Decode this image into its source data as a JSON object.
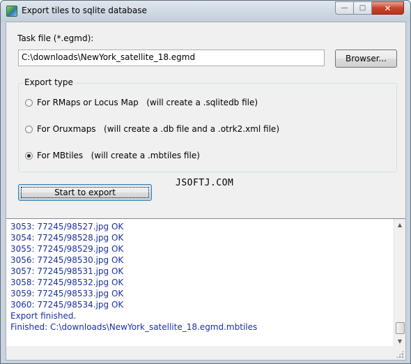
{
  "window": {
    "title": "Export tiles to sqlite database",
    "icon": "map-app-icon",
    "controls": {
      "minimize": "minimize-icon",
      "maximize": "maximize-icon",
      "close": "close-icon"
    }
  },
  "task": {
    "label": "Task file (*.egmd):",
    "value": "C:\\downloads\\NewYork_satellite_18.egmd",
    "browse_label": "Browser..."
  },
  "export_type": {
    "title": "Export type",
    "options": [
      {
        "label": "For RMaps or Locus Map   (will create a .sqlitedb file)",
        "selected": false
      },
      {
        "label": "For Oruxmaps   (will create a .db file and a .otrk2.xml file)",
        "selected": false
      },
      {
        "label": "For MBtiles   (will create a .mbtiles file)",
        "selected": true
      }
    ]
  },
  "start_button": {
    "label": "Start to export"
  },
  "watermark": "JSOFTJ.COM",
  "log": {
    "lines": [
      "3053: 77245/98527.jpg OK",
      "3054: 77245/98528.jpg OK",
      "3055: 77245/98529.jpg OK",
      "3056: 77245/98530.jpg OK",
      "3057: 77245/98531.jpg OK",
      "3058: 77245/98532.jpg OK",
      "3059: 77245/98533.jpg OK",
      "3060: 77245/98534.jpg OK",
      "Export finished.",
      "Finished: C:\\downloads\\NewYork_satellite_18.egmd.mbtiles"
    ],
    "text_color": "#1a2fa0"
  },
  "colors": {
    "close_button": "#c7432d",
    "log_text": "#1a2fa0",
    "client_bg": "#f0f0f0"
  }
}
